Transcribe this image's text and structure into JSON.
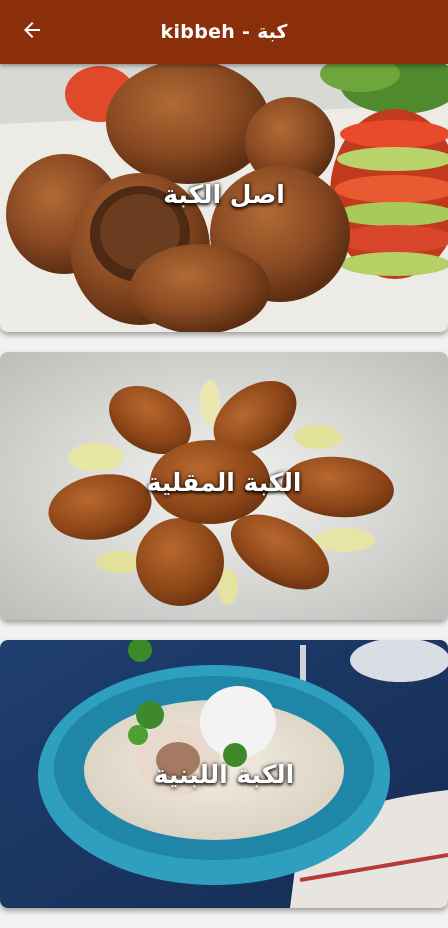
{
  "appbar": {
    "title": "kibbeh - كبة",
    "back_icon": "arrow-left-icon",
    "background": "#8a2f0a"
  },
  "recipes": [
    {
      "label": "اصل الكبة"
    },
    {
      "label": "الكبة المقلية"
    },
    {
      "label": "الكبة اللبنية"
    }
  ]
}
